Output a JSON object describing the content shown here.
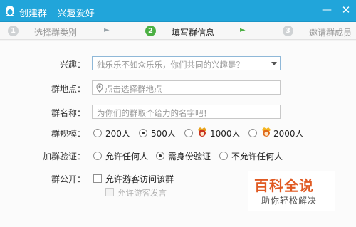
{
  "window": {
    "title": "创建群 – 兴趣爱好",
    "minimize_glyph": "—",
    "close_glyph": "✕"
  },
  "steps": [
    {
      "number": "1",
      "label": "选择群类别",
      "state": "done"
    },
    {
      "number": "2",
      "label": "填写群信息",
      "state": "active"
    },
    {
      "number": "3",
      "label": "邀请群成员",
      "state": "pending"
    }
  ],
  "step_arrow_glyph": "►",
  "form": {
    "interest": {
      "label": "兴趣：",
      "placeholder": "独乐乐不如众乐乐，你们共同的兴趣是？"
    },
    "location": {
      "label": "群地点：",
      "placeholder": "点击选择群地点"
    },
    "name": {
      "label": "群名称：",
      "placeholder": "为你们的群取个给力的名字吧！"
    },
    "size": {
      "label": "群规模：",
      "options": [
        "200人",
        "500人",
        "1000人",
        "2000人"
      ],
      "selected": "500人"
    },
    "verify": {
      "label": "加群验证：",
      "options": [
        "允许任何人",
        "需身份验证",
        "不允许任何人"
      ],
      "selected": "需身份验证"
    },
    "public": {
      "label": "群公开：",
      "allow_guest": "允许游客访问该群",
      "allow_guest_post": "允许游客发言"
    }
  },
  "watermark": {
    "title": "百科全说",
    "subtitle": "助你轻松解决"
  },
  "colors": {
    "titlebar": "#21a5da",
    "active_step": "#4cb044",
    "watermark": "#e05a23"
  }
}
